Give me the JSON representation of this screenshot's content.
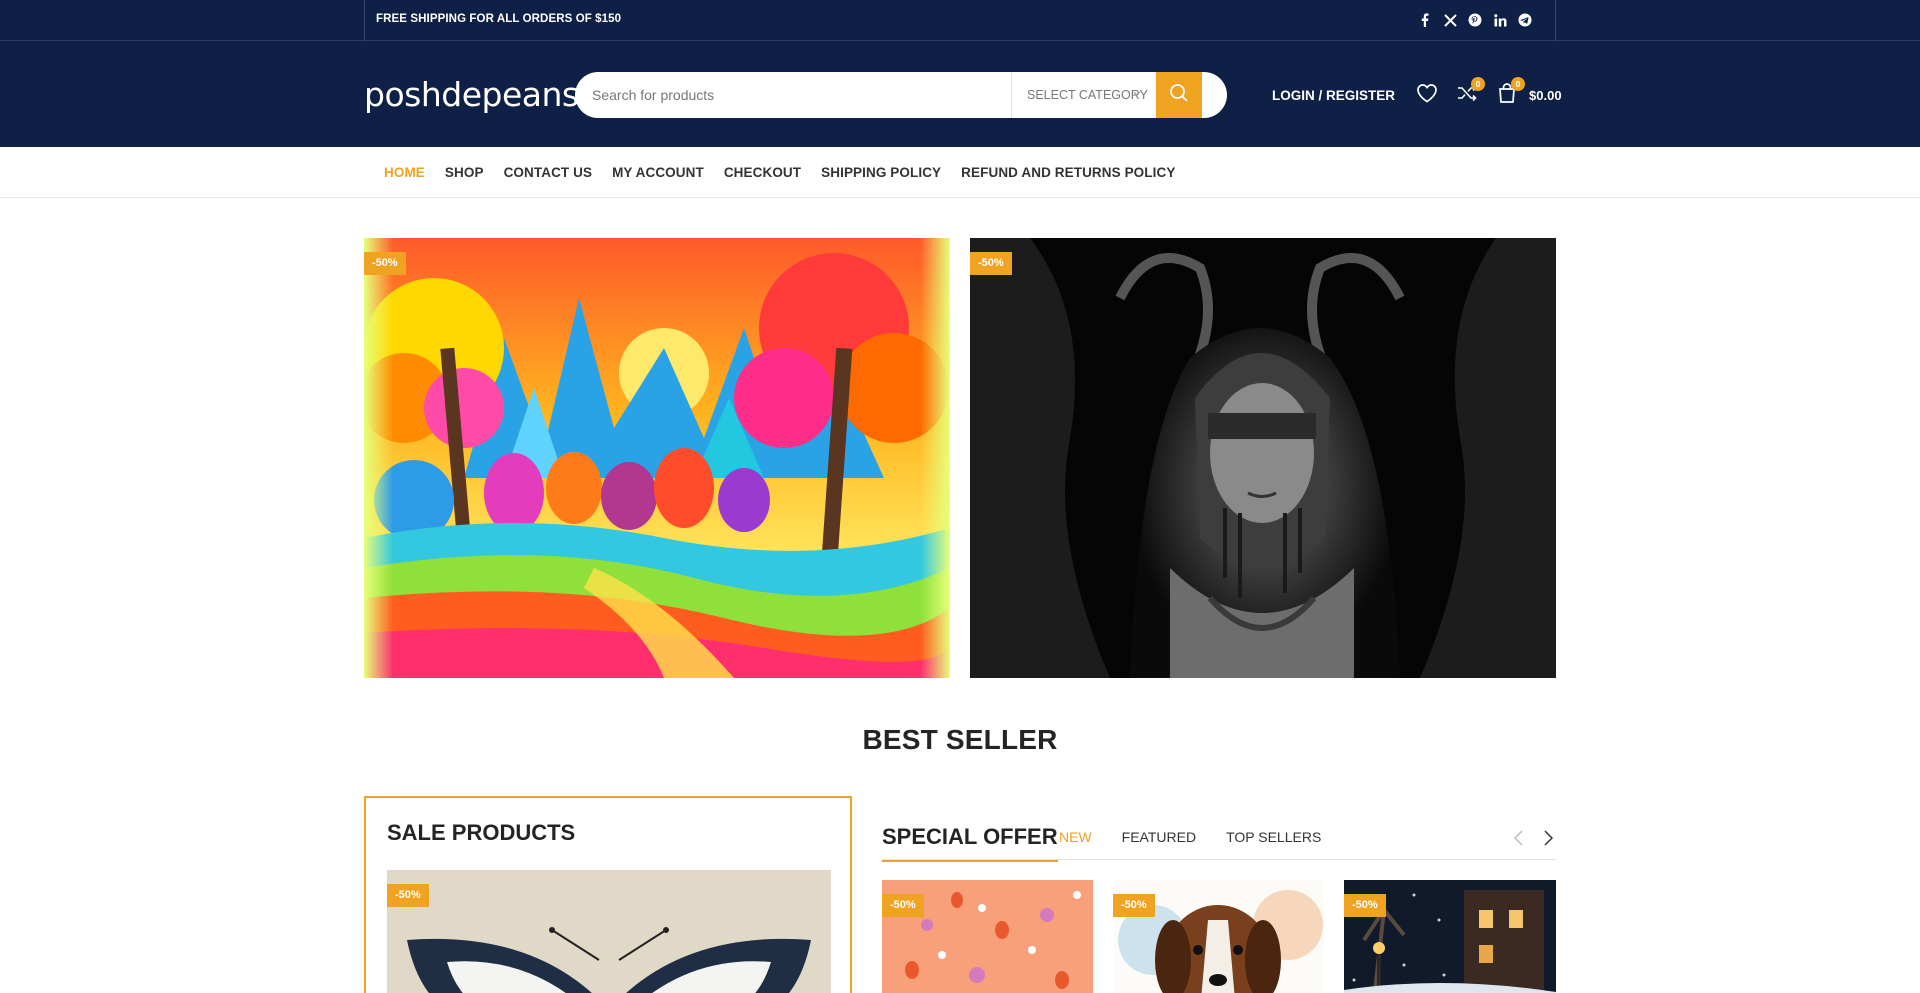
{
  "topbar": {
    "shipping_text": "FREE SHIPPING FOR ALL ORDERS OF $150",
    "social": [
      "facebook-icon",
      "x-icon",
      "pinterest-icon",
      "linkedin-icon",
      "telegram-icon"
    ]
  },
  "header": {
    "logo": "poshdepeans",
    "search_placeholder": "Search for products",
    "category_label": "SELECT CATEGORY",
    "login_label": "LOGIN / REGISTER",
    "compare_count": "0",
    "cart_count": "0",
    "cart_total": "$0.00"
  },
  "nav": {
    "items": [
      "HOME",
      "SHOP",
      "CONTACT US",
      "MY ACCOUNT",
      "CHECKOUT",
      "SHIPPING POLICY",
      "REFUND AND RETURNS POLICY"
    ]
  },
  "banners": {
    "left_badge": "-50%",
    "right_badge": "-50%"
  },
  "best_seller": {
    "title": "BEST SELLER"
  },
  "sale_products": {
    "title": "SALE PRODUCTS",
    "badge": "-50%"
  },
  "special_offer": {
    "title": "SPECIAL OFFER",
    "tabs": [
      "NEW",
      "FEATURED",
      "TOP SELLERS"
    ],
    "products": [
      {
        "badge": "-50%"
      },
      {
        "badge": "-50%"
      },
      {
        "badge": "-50%"
      }
    ]
  },
  "colors": {
    "brand_navy": "#0f2046",
    "accent": "#f0a221"
  }
}
